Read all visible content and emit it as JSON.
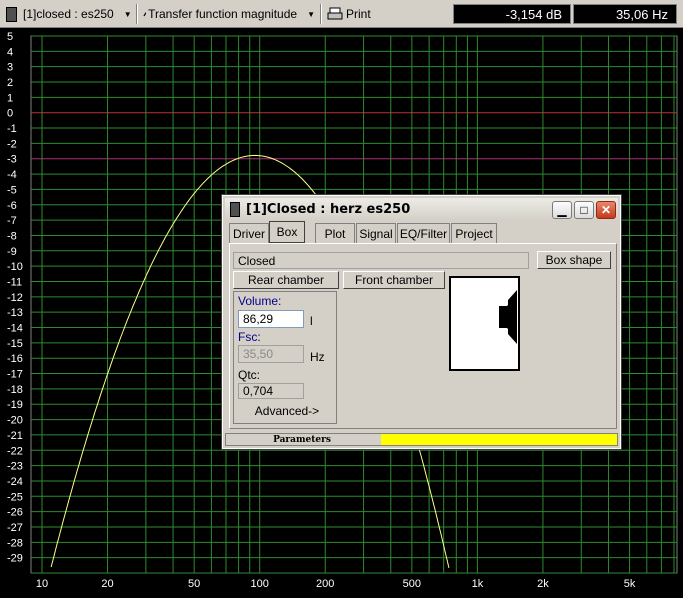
{
  "toolbar": {
    "design_select": "[1]closed : es250",
    "view_select": "Transfer function magnitude",
    "print_label": "Print",
    "readout_db": "-3,154 dB",
    "readout_hz": "35,06 Hz"
  },
  "plot": {
    "y_ticks": [
      "5",
      "4",
      "3",
      "2",
      "1",
      "0",
      "-1",
      "-2",
      "-3",
      "-4",
      "-5",
      "-6",
      "-7",
      "-8",
      "-9",
      "-10",
      "-11",
      "-12",
      "-13",
      "-14",
      "-15",
      "-16",
      "-17",
      "-18",
      "-19",
      "-20",
      "-21",
      "-22",
      "-23",
      "-24",
      "-25",
      "-26",
      "-27",
      "-28",
      "-29"
    ],
    "x_ticks": [
      "10",
      "20",
      "50",
      "100",
      "200",
      "500",
      "1k",
      "2k",
      "5k"
    ],
    "colors": {
      "grid": "#2e8b2e",
      "curve": "#ffff88",
      "zero_line": "#c03030",
      "minus3_line": "#b0307a",
      "background": "#000000"
    }
  },
  "dialog": {
    "title": "[1]Closed : herz es250",
    "tabs": [
      "Driver",
      "Box",
      "Plot",
      "Signal",
      "EQ/Filter",
      "Project"
    ],
    "active_tab": "Box",
    "box_type": "Closed",
    "box_shape_button": "Box shape",
    "rear_chamber_button": "Rear chamber",
    "front_chamber_button": "Front chamber",
    "volume_label": "Volume:",
    "volume_value": "86,29",
    "volume_unit": "l",
    "fsc_label": "Fsc:",
    "fsc_value": "35,50",
    "fsc_unit": "Hz",
    "qtc_label": "Qtc:",
    "qtc_value": "0,704",
    "advanced_button": "Advanced->",
    "status_label": "Parameters",
    "status_color": "#ffff00"
  }
}
